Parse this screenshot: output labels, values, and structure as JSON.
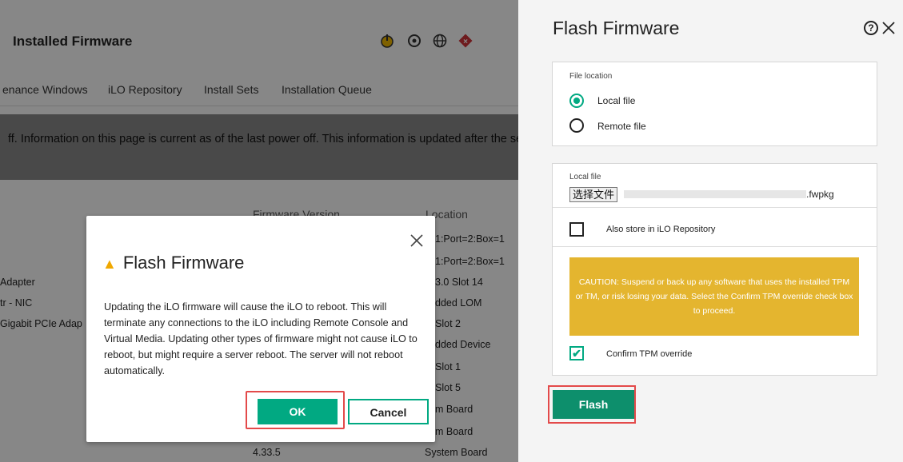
{
  "background_page": {
    "title": "Installed Firmware",
    "tabs": [
      "enance Windows",
      "iLO Repository",
      "Install Sets",
      "Installation Queue"
    ],
    "banner_text": "ff. Information on this page is current as of the last power off. This information is updated after the ser",
    "columns": {
      "firmware_version": "Firmware Version",
      "location": "Location"
    },
    "row_names": [
      "Adapter",
      "tr - NIC",
      "Gigabit PCIe Adap"
    ],
    "locations": [
      "1:Port=2:Box=1",
      "1:Port=2:Box=1",
      "3.0 Slot 14",
      "dded LOM",
      "Slot 2",
      "dded Device",
      "Slot 1",
      "Slot 5",
      "m Board",
      "m Board",
      "System Board"
    ],
    "last_version": "4.33.5",
    "header_icons": [
      "power-icon",
      "locate-icon",
      "globe-icon",
      "alert-diamond-icon"
    ]
  },
  "modal": {
    "title": "Flash Firmware",
    "body": "Updating the iLO firmware will cause the iLO to reboot. This will terminate any connections to the iLO including Remote Console and Virtual Media. Updating other types of firmware might not cause iLO to reboot, but might require a server reboot. The server will not reboot automatically.",
    "ok_label": "OK",
    "cancel_label": "Cancel"
  },
  "panel": {
    "title": "Flash Firmware",
    "help_glyph": "?",
    "file_location_label": "File location",
    "options": [
      "Local file",
      "Remote file"
    ],
    "selected_option": "Local file",
    "local_file_label": "Local file",
    "choose_file_label": "选择文件",
    "file_ext": ".fwpkg",
    "store_repo_label": "Also store in iLO Repository",
    "store_repo_checked": false,
    "caution_text": "CAUTION: Suspend or back up any software that uses the installed TPM or TM, or risk losing your data. Select the Confirm TPM override check box to proceed.",
    "confirm_tpm_label": "Confirm TPM override",
    "confirm_tpm_checked": true,
    "flash_label": "Flash"
  },
  "colors": {
    "accent": "#01a982",
    "caution": "#e4b52f",
    "highlight": "#e34a4a"
  }
}
